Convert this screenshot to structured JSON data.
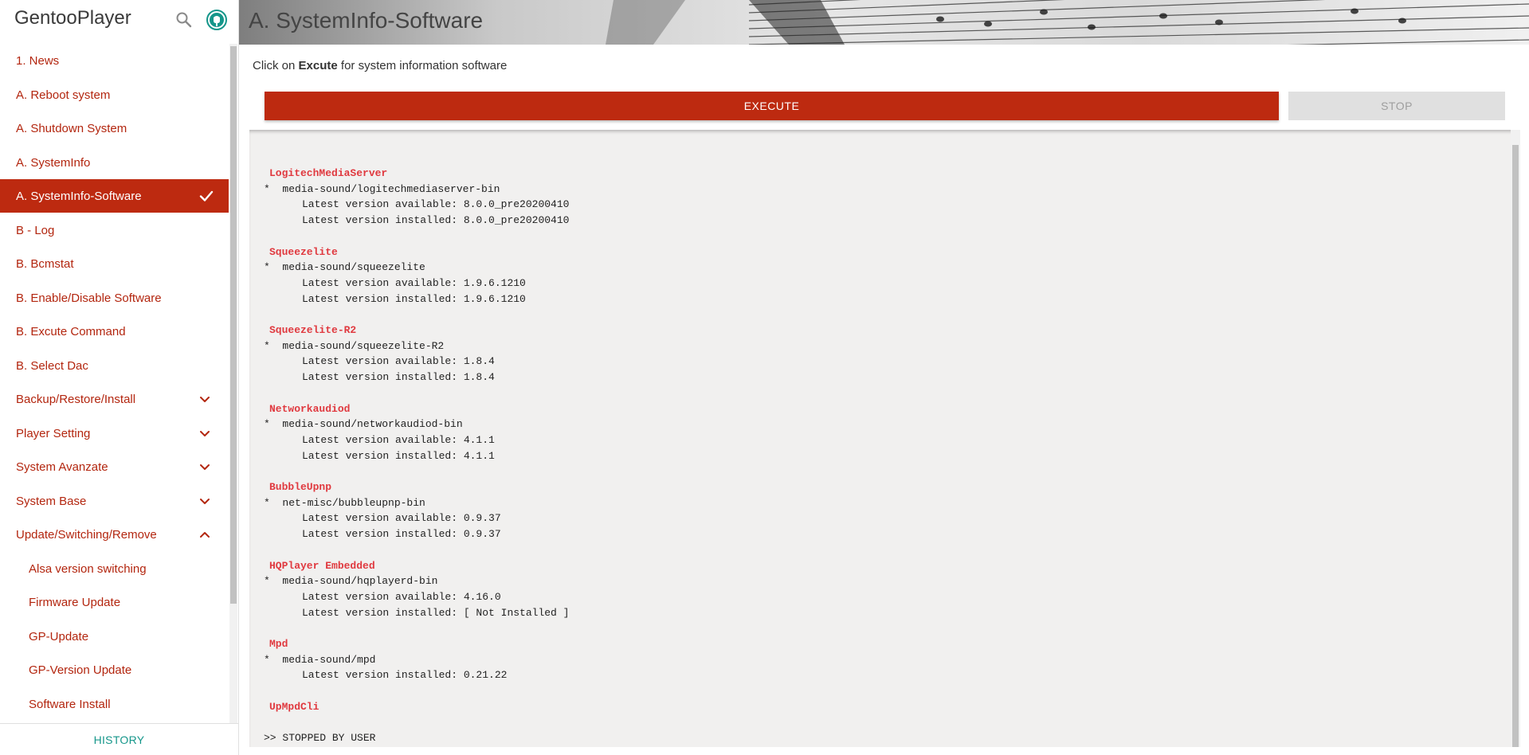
{
  "app": {
    "title": "GentooPlayer"
  },
  "colors": {
    "accent": "#bd2a10",
    "teal": "#15968a",
    "console_title": "#e0393f"
  },
  "sidebar": {
    "items": [
      {
        "label": "1. News",
        "type": "link"
      },
      {
        "label": "A. Reboot system",
        "type": "link"
      },
      {
        "label": "A. Shutdown System",
        "type": "link"
      },
      {
        "label": "A. SystemInfo",
        "type": "link"
      },
      {
        "label": "A. SystemInfo-Software",
        "type": "link",
        "active": true
      },
      {
        "label": "B - Log",
        "type": "link"
      },
      {
        "label": "B. Bcmstat",
        "type": "link"
      },
      {
        "label": "B. Enable/Disable Software",
        "type": "link"
      },
      {
        "label": "B. Excute Command",
        "type": "link"
      },
      {
        "label": "B. Select Dac",
        "type": "link"
      },
      {
        "label": "Backup/Restore/Install",
        "type": "group",
        "expanded": false
      },
      {
        "label": "Player Setting",
        "type": "group",
        "expanded": false
      },
      {
        "label": "System Avanzate",
        "type": "group",
        "expanded": false
      },
      {
        "label": "System Base",
        "type": "group",
        "expanded": false
      },
      {
        "label": "Update/Switching/Remove",
        "type": "group",
        "expanded": true
      },
      {
        "label": "Alsa version switching",
        "type": "sub"
      },
      {
        "label": "Firmware Update",
        "type": "sub"
      },
      {
        "label": "GP-Update",
        "type": "sub"
      },
      {
        "label": "GP-Version Update",
        "type": "sub"
      },
      {
        "label": "Software Install",
        "type": "sub"
      }
    ],
    "history_label": "HISTORY"
  },
  "main": {
    "title": "A. SystemInfo-Software",
    "instruction_prefix": "Click on ",
    "instruction_bold": "Excute",
    "instruction_suffix": " for system information software",
    "execute_label": "EXECUTE",
    "stop_label": "STOP"
  },
  "console": {
    "sections": [
      {
        "title": "LogitechMediaServer",
        "package": "*  media-sound/logitechmediaserver-bin",
        "lines": [
          "Latest version available: 8.0.0_pre20200410",
          "Latest version installed: 8.0.0_pre20200410"
        ]
      },
      {
        "title": "Squeezelite",
        "package": "*  media-sound/squeezelite",
        "lines": [
          "Latest version available: 1.9.6.1210",
          "Latest version installed: 1.9.6.1210"
        ]
      },
      {
        "title": "Squeezelite-R2",
        "package": "*  media-sound/squeezelite-R2",
        "lines": [
          "Latest version available: 1.8.4",
          "Latest version installed: 1.8.4"
        ]
      },
      {
        "title": "Networkaudiod",
        "package": "*  media-sound/networkaudiod-bin",
        "lines": [
          "Latest version available: 4.1.1",
          "Latest version installed: 4.1.1"
        ]
      },
      {
        "title": "BubbleUpnp",
        "package": "*  net-misc/bubbleupnp-bin",
        "lines": [
          "Latest version available: 0.9.37",
          "Latest version installed: 0.9.37"
        ]
      },
      {
        "title": "HQPlayer Embedded",
        "package": "*  media-sound/hqplayerd-bin",
        "lines": [
          "Latest version available: 4.16.0",
          "Latest version installed: [ Not Installed ]"
        ]
      },
      {
        "title": "Mpd",
        "package": "*  media-sound/mpd",
        "lines": [
          "Latest version installed: 0.21.22"
        ]
      },
      {
        "title": "UpMpdCli",
        "package": "",
        "lines": []
      }
    ],
    "footer": ">> STOPPED BY USER"
  },
  "icons": {
    "search": "search-icon",
    "github": "github-icon",
    "check": "check-icon",
    "chevron_down": "chevron-down-icon",
    "chevron_up": "chevron-up-icon"
  }
}
